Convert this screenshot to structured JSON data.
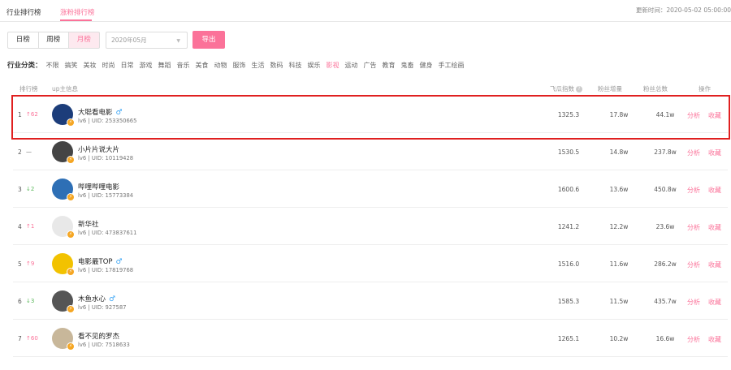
{
  "tabs": {
    "industry": "行业排行榜",
    "rising": "涨粉排行榜"
  },
  "update_time": "更新时间：2020-05-02 05:00:00",
  "period_tabs": [
    "日榜",
    "周榜",
    "月榜"
  ],
  "month_select": {
    "value": "2020年05月"
  },
  "export_label": "导出",
  "category": {
    "label": "行业分类：",
    "items": [
      "不限",
      "搞笑",
      "美妆",
      "时尚",
      "日常",
      "游戏",
      "舞蹈",
      "音乐",
      "美食",
      "动物",
      "服饰",
      "生活",
      "数码",
      "科技",
      "娱乐",
      "影视",
      "运动",
      "广告",
      "教育",
      "鬼畜",
      "健身",
      "手工绘画"
    ],
    "active": "影视"
  },
  "table_headers": {
    "rank": "排行榜",
    "up": "up主信息",
    "index": "飞瓜指数",
    "growth": "粉丝增量",
    "total": "粉丝总数",
    "ops": "操作"
  },
  "help_icon": "?",
  "actions": {
    "analyze": "分析",
    "favorite": "收藏"
  },
  "rows": [
    {
      "rank": "1",
      "delta": "↑62",
      "dir": "up",
      "name": "大聪看电影",
      "gender": "♂",
      "level": "lv6",
      "uid": "UID: 253350665",
      "index": "1325.3",
      "growth": "17.8w",
      "total": "44.1w",
      "avatar_color": "#1c3d7a"
    },
    {
      "rank": "2",
      "delta": "—",
      "dir": "same",
      "name": "小片片说大片",
      "gender": "",
      "level": "lv6",
      "uid": "UID: 10119428",
      "index": "1530.5",
      "growth": "14.8w",
      "total": "237.8w",
      "avatar_color": "#444444"
    },
    {
      "rank": "3",
      "delta": "↓2",
      "dir": "down",
      "name": "哔哩哔哩电影",
      "gender": "",
      "level": "lv6",
      "uid": "UID: 15773384",
      "index": "1600.6",
      "growth": "13.6w",
      "total": "450.8w",
      "avatar_color": "#2e6fb5"
    },
    {
      "rank": "4",
      "delta": "↑1",
      "dir": "up",
      "name": "新华社",
      "gender": "",
      "level": "lv6",
      "uid": "UID: 473837611",
      "index": "1241.2",
      "growth": "12.2w",
      "total": "23.6w",
      "avatar_color": "#e8e8e8"
    },
    {
      "rank": "5",
      "delta": "↑9",
      "dir": "up",
      "name": "电影最TOP",
      "gender": "♂",
      "level": "lv6",
      "uid": "UID: 17819768",
      "index": "1516.0",
      "growth": "11.6w",
      "total": "286.2w",
      "avatar_color": "#f2c200"
    },
    {
      "rank": "6",
      "delta": "↓3",
      "dir": "down",
      "name": "木鱼水心",
      "gender": "♂",
      "level": "lv6",
      "uid": "UID: 927587",
      "index": "1585.3",
      "growth": "11.5w",
      "total": "435.7w",
      "avatar_color": "#555555"
    },
    {
      "rank": "7",
      "delta": "↑60",
      "dir": "up",
      "name": "看不见的罗杰",
      "gender": "",
      "level": "lv6",
      "uid": "UID: 7518633",
      "index": "1265.1",
      "growth": "10.2w",
      "total": "16.6w",
      "avatar_color": "#c8b79a"
    }
  ],
  "colors": {
    "accent": "#fb7299",
    "up": "#fb7299",
    "down": "#5ab85a",
    "highlight": "#e02020",
    "gender": "#3ba5f5"
  }
}
